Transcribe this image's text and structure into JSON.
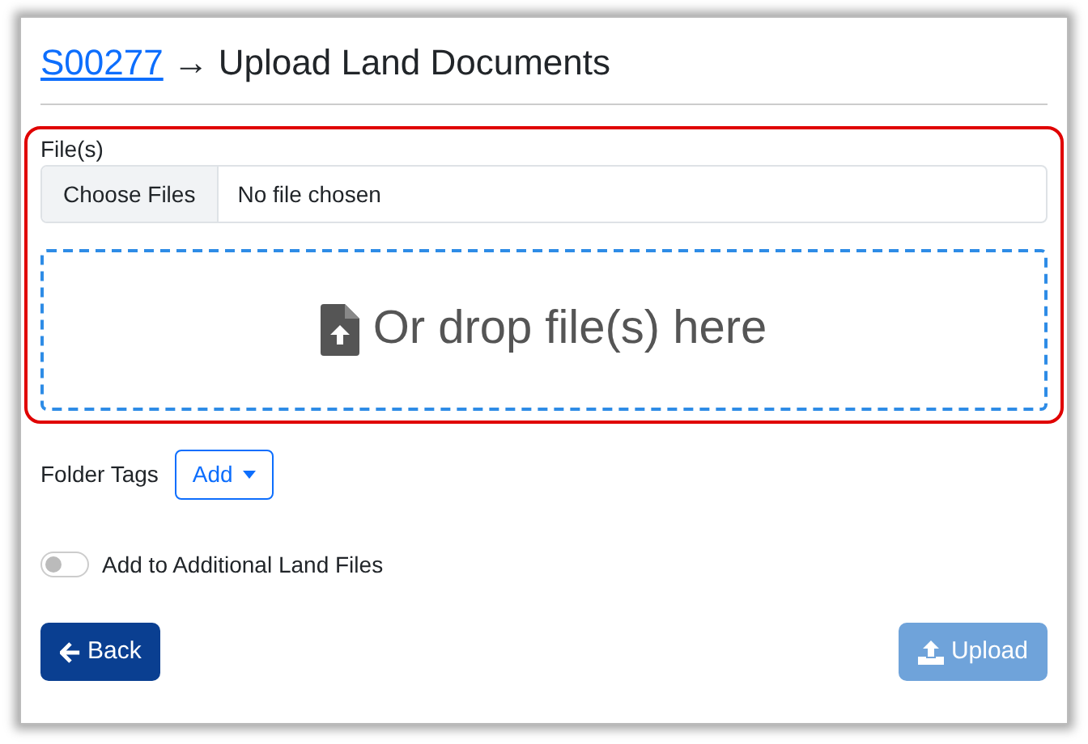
{
  "header": {
    "link": "S00277",
    "arrow": "→",
    "title": "Upload Land Documents"
  },
  "file_field": {
    "label": "File(s)",
    "button": "Choose Files",
    "status": "No file chosen"
  },
  "drop_zone": {
    "text": "Or drop file(s) here"
  },
  "folder_tags": {
    "label": "Folder Tags",
    "button": "Add"
  },
  "toggle": {
    "label": "Add to Additional Land Files",
    "on": false
  },
  "buttons": [
    {
      "kind": "back",
      "label": "Back",
      "disabled": false
    },
    {
      "kind": "upload",
      "label": "Upload",
      "disabled": true
    }
  ]
}
